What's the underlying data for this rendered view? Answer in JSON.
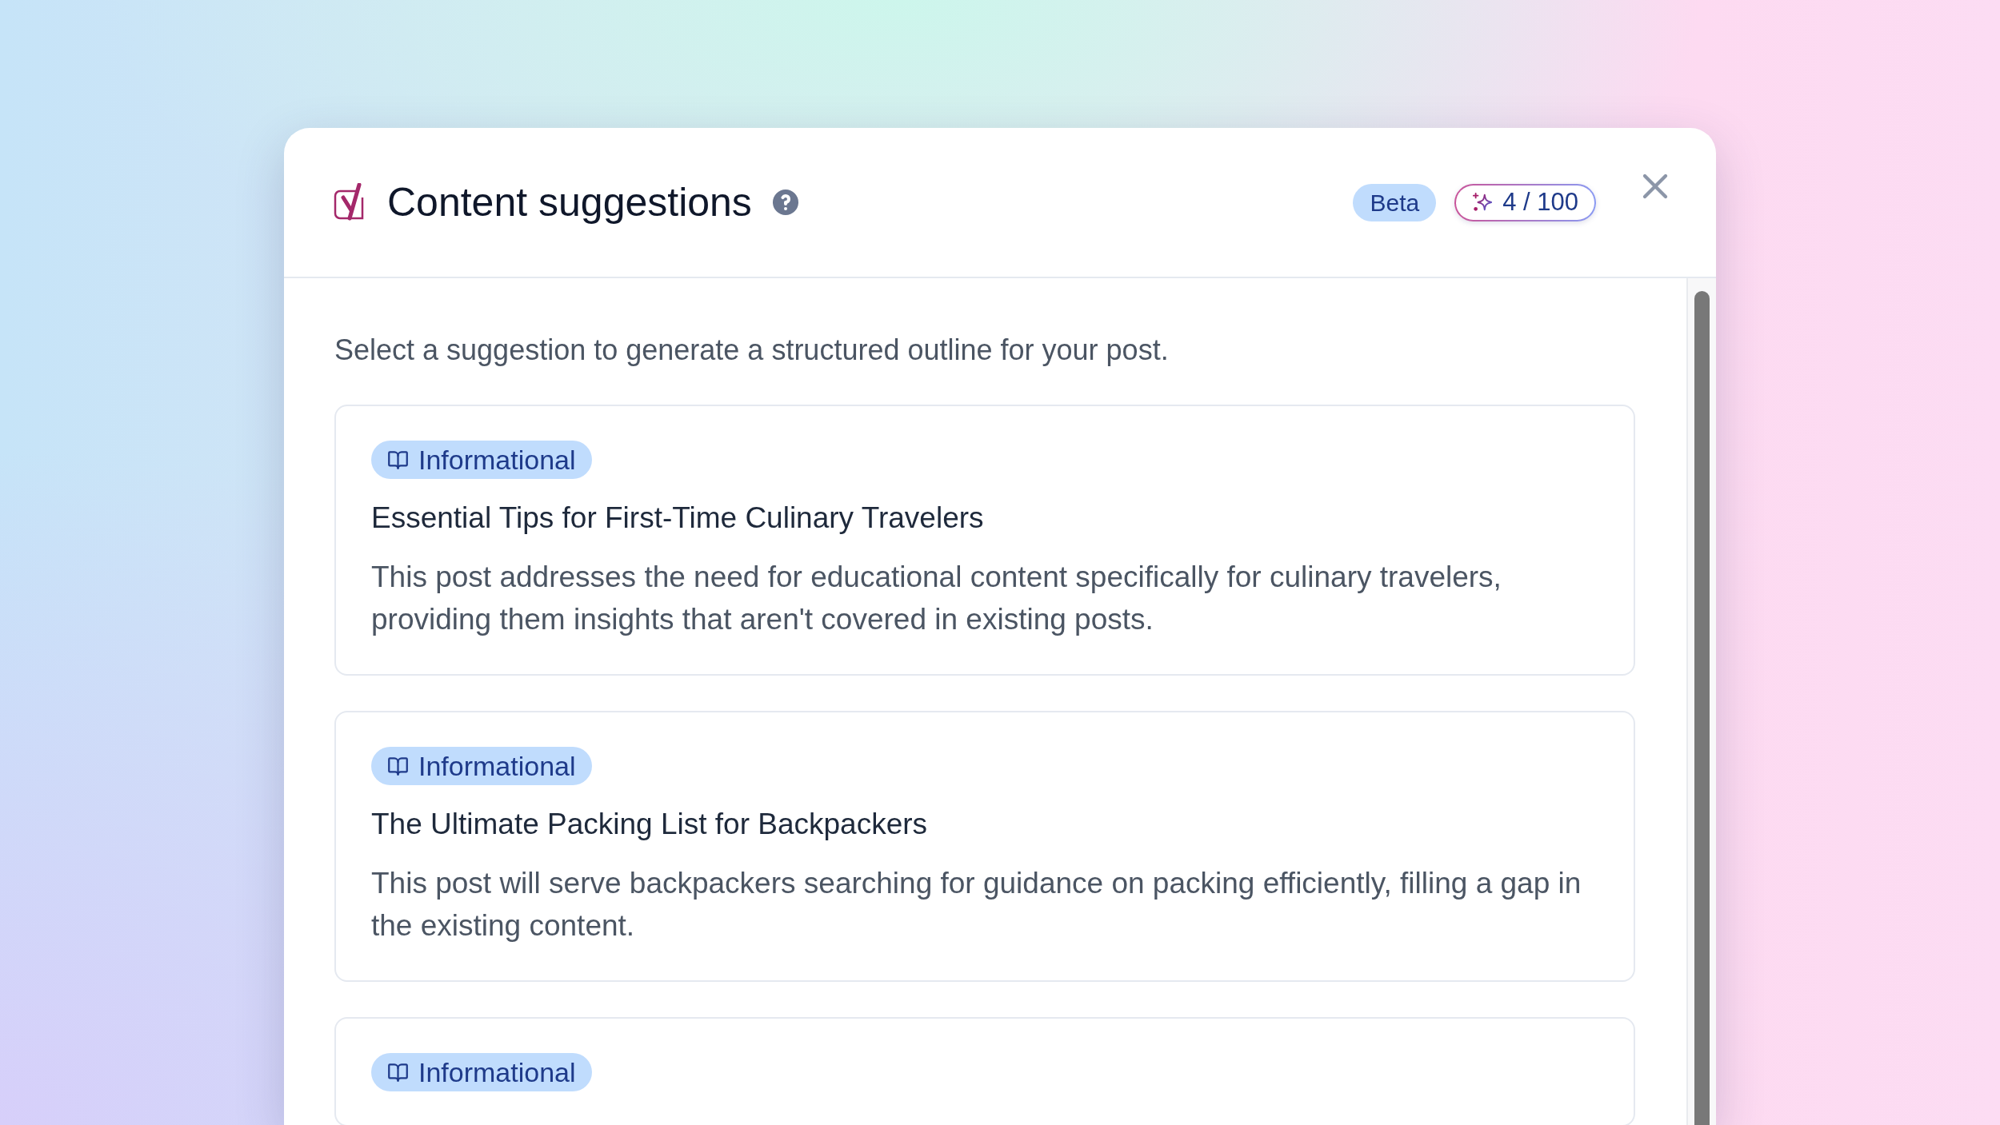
{
  "dialog": {
    "title": "Content suggestions",
    "status_tag": "Beta",
    "usage": "4 / 100"
  },
  "intro": "Select a suggestion to generate a structured outline for your post.",
  "suggestions": [
    {
      "intent": "Informational",
      "title": "Essential Tips for First-Time Culinary Travelers",
      "description": "This post addresses the need for educational content specifically for culinary travelers, providing them insights that aren't covered in existing posts."
    },
    {
      "intent": "Informational",
      "title": "The Ultimate Packing List for Backpackers",
      "description": "This post will serve backpackers searching for guidance on packing efficiently, filling a gap in the existing content."
    },
    {
      "intent": "Informational"
    }
  ]
}
